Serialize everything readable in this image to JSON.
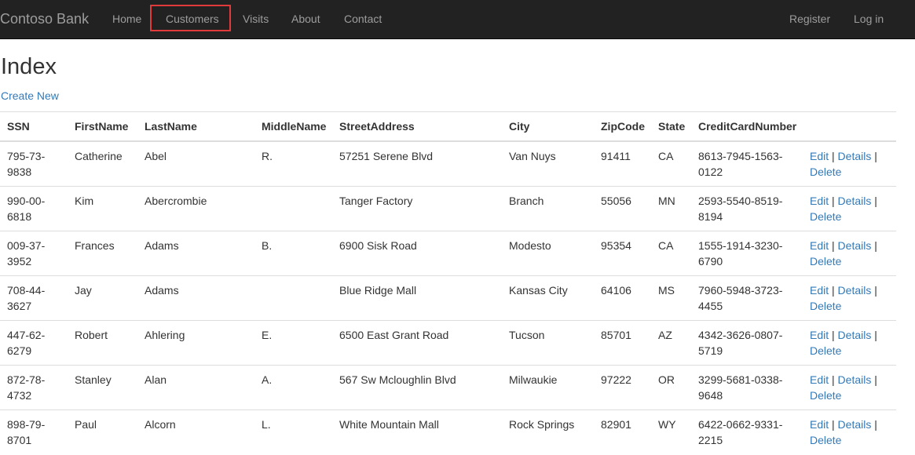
{
  "nav": {
    "brand": "Contoso Bank",
    "links": [
      "Home",
      "Customers",
      "Visits",
      "About",
      "Contact"
    ],
    "right_links": [
      "Register",
      "Log in"
    ],
    "active": "Customers",
    "highlight_color": "#e03a3a",
    "bg_color": "#222222"
  },
  "page": {
    "title": "Index",
    "create_new": "Create New"
  },
  "table": {
    "headers": [
      "SSN",
      "FirstName",
      "LastName",
      "MiddleName",
      "StreetAddress",
      "City",
      "ZipCode",
      "State",
      "CreditCardNumber"
    ],
    "action_labels": {
      "edit": "Edit",
      "details": "Details",
      "delete": "Delete",
      "separator": "|"
    },
    "rows": [
      {
        "ssn": "795-73-9838",
        "first": "Catherine",
        "last": "Abel",
        "middle": "R.",
        "street": "57251 Serene Blvd",
        "city": "Van Nuys",
        "zip": "91411",
        "state": "CA",
        "card": "8613-7945-1563-0122"
      },
      {
        "ssn": "990-00-6818",
        "first": "Kim",
        "last": "Abercrombie",
        "middle": "",
        "street": "Tanger Factory",
        "city": "Branch",
        "zip": "55056",
        "state": "MN",
        "card": "2593-5540-8519-8194"
      },
      {
        "ssn": "009-37-3952",
        "first": "Frances",
        "last": "Adams",
        "middle": "B.",
        "street": "6900 Sisk Road",
        "city": "Modesto",
        "zip": "95354",
        "state": "CA",
        "card": "1555-1914-3230-6790"
      },
      {
        "ssn": "708-44-3627",
        "first": "Jay",
        "last": "Adams",
        "middle": "",
        "street": "Blue Ridge Mall",
        "city": "Kansas City",
        "zip": "64106",
        "state": "MS",
        "card": "7960-5948-3723-4455"
      },
      {
        "ssn": "447-62-6279",
        "first": "Robert",
        "last": "Ahlering",
        "middle": "E.",
        "street": "6500 East Grant Road",
        "city": "Tucson",
        "zip": "85701",
        "state": "AZ",
        "card": "4342-3626-0807-5719"
      },
      {
        "ssn": "872-78-4732",
        "first": "Stanley",
        "last": "Alan",
        "middle": "A.",
        "street": "567 Sw Mcloughlin Blvd",
        "city": "Milwaukie",
        "zip": "97222",
        "state": "OR",
        "card": "3299-5681-0338-9648"
      },
      {
        "ssn": "898-79-8701",
        "first": "Paul",
        "last": "Alcorn",
        "middle": "L.",
        "street": "White Mountain Mall",
        "city": "Rock Springs",
        "zip": "82901",
        "state": "WY",
        "card": "6422-0662-9331-2215"
      }
    ]
  }
}
